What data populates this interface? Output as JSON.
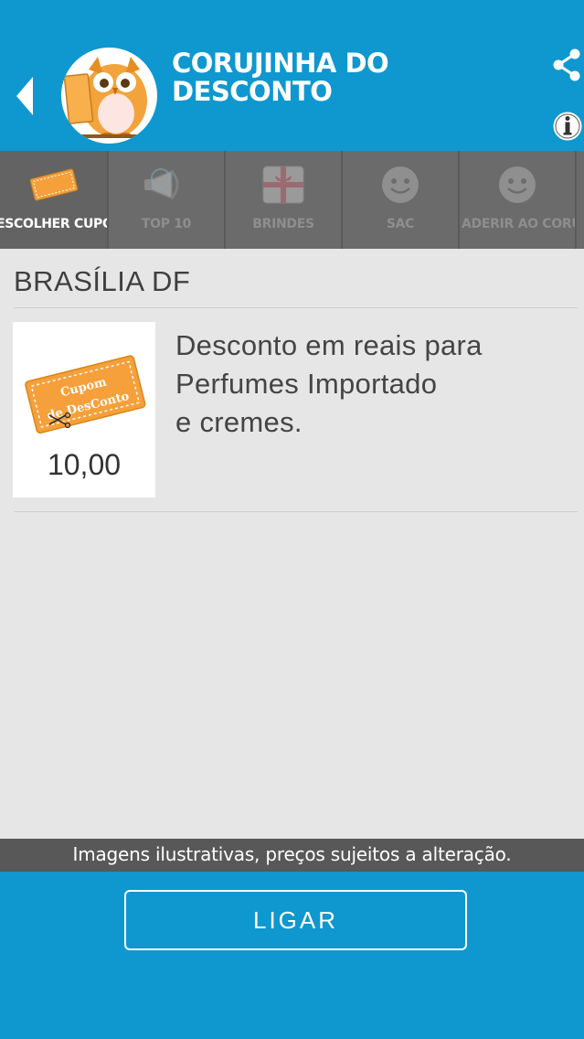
{
  "header": {
    "title_line1": "CORUJINHA DO",
    "title_line2": "DESCONTO",
    "back_icon": "chevron-left-icon",
    "share_icon": "share-icon",
    "info_icon": "info-icon"
  },
  "tabs": [
    {
      "label": "ESCOLHER CUPOM",
      "icon": "coupon-icon",
      "active": true
    },
    {
      "label": "TOP 10",
      "icon": "megaphone-icon",
      "active": false
    },
    {
      "label": "BRINDES",
      "icon": "gift-icon",
      "active": false
    },
    {
      "label": "SAC",
      "icon": "smiley-icon",
      "active": false
    },
    {
      "label": "ADERIR AO CORUJINHA",
      "icon": "smiley-icon",
      "active": false
    }
  ],
  "main": {
    "section_title": "BRASÍLIA DF",
    "coupon": {
      "badge_line1": "Cupom",
      "badge_line2": "de DesConto",
      "price": "10,00",
      "description": "Desconto em reais para\nPerfumes Importado\ne cremes."
    }
  },
  "disclaimer": "Imagens ilustrativas, preços sujeitos a alteração.",
  "footer": {
    "call_label": "LIGAR"
  },
  "colors": {
    "primary": "#0e98cf",
    "tab_bar": "#6b6b6b",
    "background": "#e6e6e6",
    "coupon_orange": "#f5a03a"
  }
}
